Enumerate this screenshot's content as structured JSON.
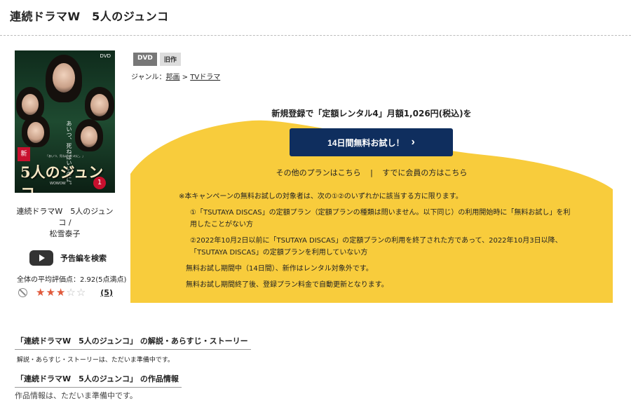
{
  "page": {
    "title": "連続ドラマW　5人のジュンコ"
  },
  "poster": {
    "dvd_tag": "DVD",
    "badge": "新",
    "title_art": "5人のジュンコ",
    "vol": "1",
    "quote": "あいつ、死ねばいいのに。",
    "tagline": "「あいつ、死ねばいいのに。」",
    "network": "WOWOW"
  },
  "sidebar": {
    "title_line1": "連続ドラマW　5人のジュンコ /",
    "title_line2": "松雪泰子",
    "trailer_label": "予告編を検索",
    "rating_label": "全体の平均評価点：2.92(5点満点)",
    "rating_value": 2.92,
    "rating_max": 5,
    "rating_count": "(5)"
  },
  "badges": {
    "dvd": "DVD",
    "old": "旧作"
  },
  "genre": {
    "label": "ジャンル：",
    "first": "邦画",
    "sep": " > ",
    "second": "TVドラマ"
  },
  "promo": {
    "headline": "新規登録で「定額レンタル4」月額1,026円(税込)を",
    "cta_label": "14日間無料お試し！",
    "cta_arrow": "›",
    "other_plans": "その他のプランはこちら",
    "member_link": "すでに会員の方はこちら",
    "link_sep": "|",
    "bg_color": "#f8cc3c",
    "cta_color": "#0f2e5e"
  },
  "notice": {
    "line0": "※本キャンペーンの無料お試しの対象者は、次の①②のいずれかに該当する方に限ります。",
    "line1": "①「TSUTAYA DISCAS」の定額プラン（定額プランの種類は問いません。以下同じ）の利用開始時に「無料お試し」を利用したことがない方",
    "line2": "②2022年10月2日以前に「TSUTAYA DISCAS」の定額プランの利用を終了された方であって、2022年10月3日以降、「TSUTAYA DISCAS」の定額プランを利用していない方",
    "line3": "無料お試し期間中（14日間）、新作はレンタル対象外です。",
    "line4": "無料お試し期間終了後、登録プラン料金で自動更新となります。"
  },
  "sections": {
    "story_heading": "「連続ドラマW　5人のジュンコ」 の解説・あらすじ・ストーリー",
    "story_text": "解説・あらすじ・ストーリーは、ただいま準備中です。",
    "info_heading": "「連続ドラマW　5人のジュンコ」 の作品情報",
    "info_text": "作品情報は、ただいま準備中です。"
  }
}
